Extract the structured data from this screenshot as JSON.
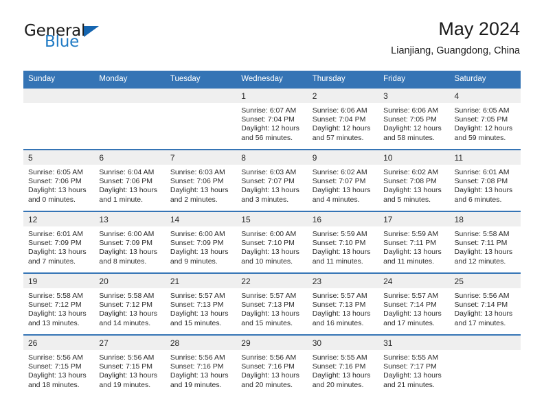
{
  "brand": {
    "name_part1": "General",
    "name_part2": "Blue",
    "logo_icon": "triangle-flag-icon"
  },
  "header": {
    "title": "May 2024",
    "subtitle": "Lianjiang, Guangdong, China"
  },
  "colors": {
    "header_blue": "#3574b5",
    "daynum_band": "#efefef",
    "brand_blue": "#1f7ac4",
    "text": "#2a2a2a"
  },
  "weekday_headers": [
    "Sunday",
    "Monday",
    "Tuesday",
    "Wednesday",
    "Thursday",
    "Friday",
    "Saturday"
  ],
  "weeks": [
    [
      {
        "day": "",
        "blank": true,
        "sunrise": "",
        "sunset": "",
        "daylight_1": "",
        "daylight_2": ""
      },
      {
        "day": "",
        "blank": true,
        "sunrise": "",
        "sunset": "",
        "daylight_1": "",
        "daylight_2": ""
      },
      {
        "day": "",
        "blank": true,
        "sunrise": "",
        "sunset": "",
        "daylight_1": "",
        "daylight_2": ""
      },
      {
        "day": "1",
        "sunrise": "Sunrise: 6:07 AM",
        "sunset": "Sunset: 7:04 PM",
        "daylight_1": "Daylight: 12 hours",
        "daylight_2": "and 56 minutes."
      },
      {
        "day": "2",
        "sunrise": "Sunrise: 6:06 AM",
        "sunset": "Sunset: 7:04 PM",
        "daylight_1": "Daylight: 12 hours",
        "daylight_2": "and 57 minutes."
      },
      {
        "day": "3",
        "sunrise": "Sunrise: 6:06 AM",
        "sunset": "Sunset: 7:05 PM",
        "daylight_1": "Daylight: 12 hours",
        "daylight_2": "and 58 minutes."
      },
      {
        "day": "4",
        "sunrise": "Sunrise: 6:05 AM",
        "sunset": "Sunset: 7:05 PM",
        "daylight_1": "Daylight: 12 hours",
        "daylight_2": "and 59 minutes."
      }
    ],
    [
      {
        "day": "5",
        "sunrise": "Sunrise: 6:05 AM",
        "sunset": "Sunset: 7:06 PM",
        "daylight_1": "Daylight: 13 hours",
        "daylight_2": "and 0 minutes."
      },
      {
        "day": "6",
        "sunrise": "Sunrise: 6:04 AM",
        "sunset": "Sunset: 7:06 PM",
        "daylight_1": "Daylight: 13 hours",
        "daylight_2": "and 1 minute."
      },
      {
        "day": "7",
        "sunrise": "Sunrise: 6:03 AM",
        "sunset": "Sunset: 7:06 PM",
        "daylight_1": "Daylight: 13 hours",
        "daylight_2": "and 2 minutes."
      },
      {
        "day": "8",
        "sunrise": "Sunrise: 6:03 AM",
        "sunset": "Sunset: 7:07 PM",
        "daylight_1": "Daylight: 13 hours",
        "daylight_2": "and 3 minutes."
      },
      {
        "day": "9",
        "sunrise": "Sunrise: 6:02 AM",
        "sunset": "Sunset: 7:07 PM",
        "daylight_1": "Daylight: 13 hours",
        "daylight_2": "and 4 minutes."
      },
      {
        "day": "10",
        "sunrise": "Sunrise: 6:02 AM",
        "sunset": "Sunset: 7:08 PM",
        "daylight_1": "Daylight: 13 hours",
        "daylight_2": "and 5 minutes."
      },
      {
        "day": "11",
        "sunrise": "Sunrise: 6:01 AM",
        "sunset": "Sunset: 7:08 PM",
        "daylight_1": "Daylight: 13 hours",
        "daylight_2": "and 6 minutes."
      }
    ],
    [
      {
        "day": "12",
        "sunrise": "Sunrise: 6:01 AM",
        "sunset": "Sunset: 7:09 PM",
        "daylight_1": "Daylight: 13 hours",
        "daylight_2": "and 7 minutes."
      },
      {
        "day": "13",
        "sunrise": "Sunrise: 6:00 AM",
        "sunset": "Sunset: 7:09 PM",
        "daylight_1": "Daylight: 13 hours",
        "daylight_2": "and 8 minutes."
      },
      {
        "day": "14",
        "sunrise": "Sunrise: 6:00 AM",
        "sunset": "Sunset: 7:09 PM",
        "daylight_1": "Daylight: 13 hours",
        "daylight_2": "and 9 minutes."
      },
      {
        "day": "15",
        "sunrise": "Sunrise: 6:00 AM",
        "sunset": "Sunset: 7:10 PM",
        "daylight_1": "Daylight: 13 hours",
        "daylight_2": "and 10 minutes."
      },
      {
        "day": "16",
        "sunrise": "Sunrise: 5:59 AM",
        "sunset": "Sunset: 7:10 PM",
        "daylight_1": "Daylight: 13 hours",
        "daylight_2": "and 11 minutes."
      },
      {
        "day": "17",
        "sunrise": "Sunrise: 5:59 AM",
        "sunset": "Sunset: 7:11 PM",
        "daylight_1": "Daylight: 13 hours",
        "daylight_2": "and 11 minutes."
      },
      {
        "day": "18",
        "sunrise": "Sunrise: 5:58 AM",
        "sunset": "Sunset: 7:11 PM",
        "daylight_1": "Daylight: 13 hours",
        "daylight_2": "and 12 minutes."
      }
    ],
    [
      {
        "day": "19",
        "sunrise": "Sunrise: 5:58 AM",
        "sunset": "Sunset: 7:12 PM",
        "daylight_1": "Daylight: 13 hours",
        "daylight_2": "and 13 minutes."
      },
      {
        "day": "20",
        "sunrise": "Sunrise: 5:58 AM",
        "sunset": "Sunset: 7:12 PM",
        "daylight_1": "Daylight: 13 hours",
        "daylight_2": "and 14 minutes."
      },
      {
        "day": "21",
        "sunrise": "Sunrise: 5:57 AM",
        "sunset": "Sunset: 7:13 PM",
        "daylight_1": "Daylight: 13 hours",
        "daylight_2": "and 15 minutes."
      },
      {
        "day": "22",
        "sunrise": "Sunrise: 5:57 AM",
        "sunset": "Sunset: 7:13 PM",
        "daylight_1": "Daylight: 13 hours",
        "daylight_2": "and 15 minutes."
      },
      {
        "day": "23",
        "sunrise": "Sunrise: 5:57 AM",
        "sunset": "Sunset: 7:13 PM",
        "daylight_1": "Daylight: 13 hours",
        "daylight_2": "and 16 minutes."
      },
      {
        "day": "24",
        "sunrise": "Sunrise: 5:57 AM",
        "sunset": "Sunset: 7:14 PM",
        "daylight_1": "Daylight: 13 hours",
        "daylight_2": "and 17 minutes."
      },
      {
        "day": "25",
        "sunrise": "Sunrise: 5:56 AM",
        "sunset": "Sunset: 7:14 PM",
        "daylight_1": "Daylight: 13 hours",
        "daylight_2": "and 17 minutes."
      }
    ],
    [
      {
        "day": "26",
        "sunrise": "Sunrise: 5:56 AM",
        "sunset": "Sunset: 7:15 PM",
        "daylight_1": "Daylight: 13 hours",
        "daylight_2": "and 18 minutes."
      },
      {
        "day": "27",
        "sunrise": "Sunrise: 5:56 AM",
        "sunset": "Sunset: 7:15 PM",
        "daylight_1": "Daylight: 13 hours",
        "daylight_2": "and 19 minutes."
      },
      {
        "day": "28",
        "sunrise": "Sunrise: 5:56 AM",
        "sunset": "Sunset: 7:16 PM",
        "daylight_1": "Daylight: 13 hours",
        "daylight_2": "and 19 minutes."
      },
      {
        "day": "29",
        "sunrise": "Sunrise: 5:56 AM",
        "sunset": "Sunset: 7:16 PM",
        "daylight_1": "Daylight: 13 hours",
        "daylight_2": "and 20 minutes."
      },
      {
        "day": "30",
        "sunrise": "Sunrise: 5:55 AM",
        "sunset": "Sunset: 7:16 PM",
        "daylight_1": "Daylight: 13 hours",
        "daylight_2": "and 20 minutes."
      },
      {
        "day": "31",
        "sunrise": "Sunrise: 5:55 AM",
        "sunset": "Sunset: 7:17 PM",
        "daylight_1": "Daylight: 13 hours",
        "daylight_2": "and 21 minutes."
      },
      {
        "day": "",
        "blank": true,
        "sunrise": "",
        "sunset": "",
        "daylight_1": "",
        "daylight_2": ""
      }
    ]
  ]
}
